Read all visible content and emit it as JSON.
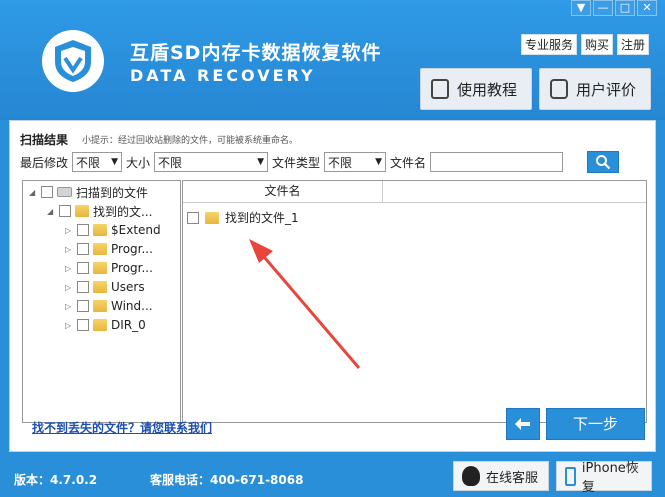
{
  "header": {
    "title": "互盾SD内存卡数据恢复软件",
    "subtitle": "DATA RECOVERY",
    "window_buttons": [
      "▼",
      "—",
      "□",
      "✕"
    ],
    "links": [
      "专业服务",
      "购买",
      "注册"
    ],
    "tutorial_label": "使用教程",
    "review_label": "用户评价"
  },
  "scan": {
    "label": "扫描结果",
    "hint": "小提示：经过回收站删除的文件，可能被系统重命名。"
  },
  "filters": {
    "modified_label": "最后修改",
    "modified_value": "不限",
    "size_label": "大小",
    "size_value": "不限",
    "type_label": "文件类型",
    "type_value": "不限",
    "name_label": "文件名",
    "name_value": ""
  },
  "tree": {
    "root": "扫描到的文件",
    "found": "找到的文...",
    "children": [
      "$Extend",
      "Progr...",
      "Progr...",
      "Users",
      "Wind...",
      "DIR_0"
    ]
  },
  "list": {
    "column_name": "文件名",
    "rows": [
      "找到的文件_1"
    ]
  },
  "contact_link": "找不到丢失的文件？请您联系我们",
  "next_label": "下一步",
  "footer": {
    "version": "版本：4.7.0.2",
    "phone": "客服电话：400-671-8068",
    "online_service": "在线客服",
    "iphone_recovery": "iPhone恢复"
  },
  "colors": {
    "brand": "#2a8fd9",
    "arrow": "#e8453c"
  }
}
